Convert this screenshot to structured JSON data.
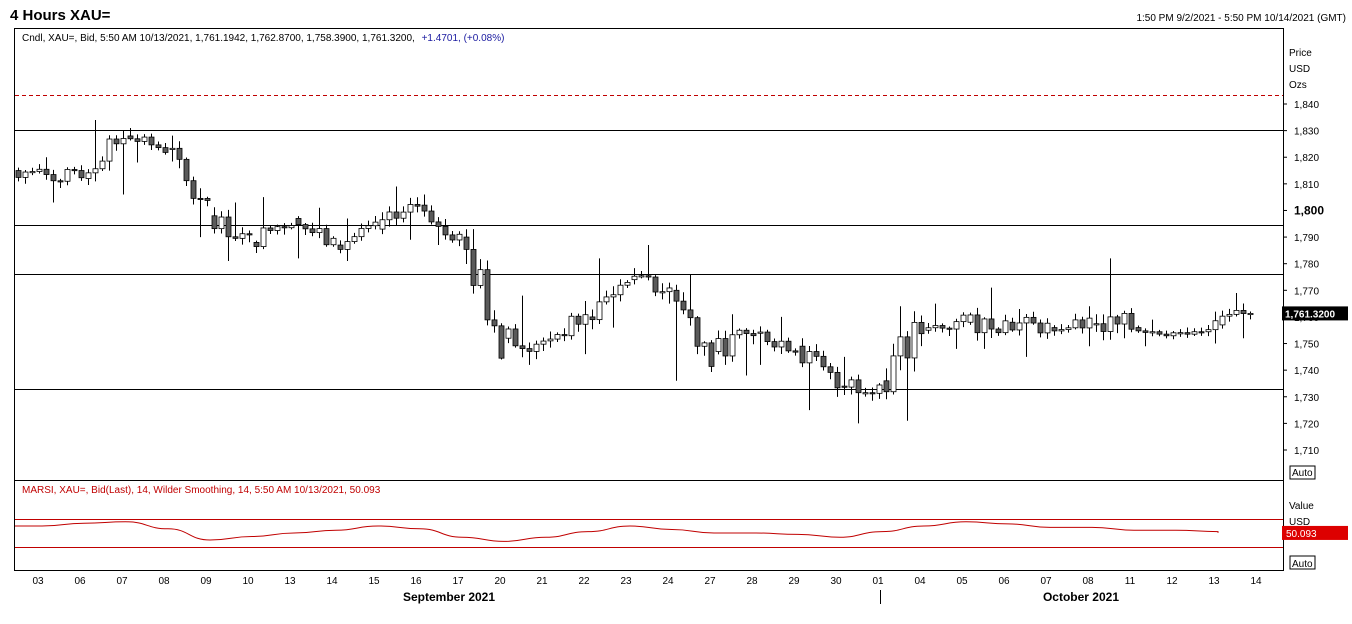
{
  "header": {
    "title": "4 Hours XAU=",
    "date_range": "1:50 PM 9/2/2021 - 5:50 PM 10/14/2021 (GMT)"
  },
  "price_panel": {
    "legend": {
      "prefix": "Cndl, XAU=, Bid, 5:50 AM 10/13/2021, 1,761.1942, 1,762.8700, 1,758.3900, 1,761.3200,",
      "change": "+1.4701, (+0.08%)"
    },
    "unit_lines": [
      "Price",
      "USD",
      "Ozs"
    ],
    "last_value_label": "1,761.3200",
    "auto_label": "Auto"
  },
  "rsi_panel": {
    "legend": "MARSI, XAU=, Bid(Last), 14, Wilder Smoothing, 14, 5:50 AM 10/13/2021, 50.093",
    "unit_lines": [
      "Value",
      "USD"
    ],
    "last_value_label": "50.093",
    "auto_label": "Auto"
  },
  "x_axis": {
    "day_labels": [
      "03",
      "06",
      "07",
      "08",
      "09",
      "10",
      "13",
      "14",
      "15",
      "16",
      "17",
      "20",
      "21",
      "22",
      "23",
      "24",
      "27",
      "28",
      "29",
      "30",
      "01",
      "04",
      "05",
      "06",
      "07",
      "08",
      "11",
      "12",
      "13",
      "14"
    ],
    "month_labels": [
      "September 2021",
      "October 2021"
    ]
  },
  "colors": {
    "up_body": "#ffffff",
    "down_body": "#5a5a5a",
    "wick": "#000000",
    "dashed_line": "#c00000",
    "rsi_line": "#c00000",
    "rsi_band": "#c00000",
    "last_label_bg": "#000000",
    "rsi_label_bg": "#dd0000",
    "change_text": "#1a1aa0",
    "rsi_legend_text": "#c00000"
  },
  "chart_data": [
    {
      "type": "candlestick",
      "title": "4 Hours XAU=",
      "y_axis": {
        "tick_labels": [
          "1,840",
          "1,830",
          "1,820",
          "1,810",
          "1,800",
          "1,790",
          "1,780",
          "1,770",
          "1,760",
          "1,750",
          "1,740",
          "1,730",
          "1,720",
          "1,710"
        ],
        "tick_values": [
          1840,
          1830,
          1820,
          1810,
          1800,
          1790,
          1780,
          1770,
          1760,
          1750,
          1740,
          1730,
          1720,
          1710
        ],
        "bold_tick": 1800,
        "range": [
          1705,
          1850
        ]
      },
      "horizontal_lines": [
        {
          "value": 1843.5,
          "style": "dashed"
        },
        {
          "value": 1830.3,
          "style": "solid"
        },
        {
          "value": 1794.6,
          "style": "solid"
        },
        {
          "value": 1776.2,
          "style": "solid"
        },
        {
          "value": 1732.8,
          "style": "solid"
        }
      ],
      "last_value": 1761.32,
      "segments": [
        {
          "day": "03",
          "start": 1815,
          "end": 1812,
          "high": 1820,
          "low": 1803,
          "bars": 10
        },
        {
          "day": "06",
          "start": 1812,
          "end": 1828,
          "high": 1834,
          "low": 1806,
          "bars": 6
        },
        {
          "day": "07",
          "start": 1828,
          "end": 1823,
          "high": 1831,
          "low": 1818,
          "bars": 6
        },
        {
          "day": "08",
          "start": 1823,
          "end": 1798,
          "high": 1826,
          "low": 1790,
          "bars": 6
        },
        {
          "day": "09",
          "start": 1798,
          "end": 1788,
          "high": 1803,
          "low": 1781,
          "bars": 6
        },
        {
          "day": "10",
          "start": 1788,
          "end": 1797,
          "high": 1805,
          "low": 1784,
          "bars": 6
        },
        {
          "day": "13",
          "start": 1797,
          "end": 1787,
          "high": 1801,
          "low": 1782,
          "bars": 6
        },
        {
          "day": "14",
          "start": 1787,
          "end": 1793,
          "high": 1797,
          "low": 1781,
          "bars": 6
        },
        {
          "day": "15",
          "start": 1793,
          "end": 1802,
          "high": 1809,
          "low": 1789,
          "bars": 6
        },
        {
          "day": "16",
          "start": 1802,
          "end": 1790,
          "high": 1806,
          "low": 1787,
          "bars": 6
        },
        {
          "day": "17",
          "start": 1790,
          "end": 1752,
          "high": 1793,
          "low": 1744,
          "bars": 6
        },
        {
          "day": "20",
          "start": 1752,
          "end": 1751,
          "high": 1768,
          "low": 1742,
          "bars": 6
        },
        {
          "day": "21",
          "start": 1751,
          "end": 1760,
          "high": 1766,
          "low": 1746,
          "bars": 6
        },
        {
          "day": "22",
          "start": 1760,
          "end": 1774,
          "high": 1782,
          "low": 1756,
          "bars": 6
        },
        {
          "day": "23",
          "start": 1774,
          "end": 1770,
          "high": 1787,
          "low": 1765,
          "bars": 6
        },
        {
          "day": "24",
          "start": 1770,
          "end": 1747,
          "high": 1776,
          "low": 1736,
          "bars": 6
        },
        {
          "day": "27",
          "start": 1747,
          "end": 1754,
          "high": 1761,
          "low": 1738,
          "bars": 6
        },
        {
          "day": "28",
          "start": 1754,
          "end": 1749,
          "high": 1760,
          "low": 1742,
          "bars": 6
        },
        {
          "day": "29",
          "start": 1749,
          "end": 1734,
          "high": 1752,
          "low": 1725,
          "bars": 6
        },
        {
          "day": "30",
          "start": 1734,
          "end": 1736,
          "high": 1745,
          "low": 1720,
          "bars": 6
        },
        {
          "day": "01",
          "start": 1736,
          "end": 1755,
          "high": 1764,
          "low": 1721,
          "bars": 6
        },
        {
          "day": "04",
          "start": 1755,
          "end": 1758,
          "high": 1765,
          "low": 1748,
          "bars": 6
        },
        {
          "day": "05",
          "start": 1758,
          "end": 1758,
          "high": 1771,
          "low": 1748,
          "bars": 6
        },
        {
          "day": "06",
          "start": 1758,
          "end": 1756,
          "high": 1763,
          "low": 1745,
          "bars": 6
        },
        {
          "day": "07",
          "start": 1756,
          "end": 1757,
          "high": 1764,
          "low": 1749,
          "bars": 6
        },
        {
          "day": "08",
          "start": 1757,
          "end": 1756,
          "high": 1782,
          "low": 1752,
          "bars": 6
        },
        {
          "day": "11",
          "start": 1756,
          "end": 1754,
          "high": 1759,
          "low": 1749,
          "bars": 6
        },
        {
          "day": "12",
          "start": 1754,
          "end": 1757,
          "high": 1762,
          "low": 1750,
          "bars": 6
        },
        {
          "day": "13",
          "start": 1757,
          "end": 1761.32,
          "high": 1769,
          "low": 1752,
          "bars": 5
        }
      ]
    },
    {
      "type": "line",
      "title": "MARSI, XAU=, Bid(Last), 14, Wilder Smoothing, 14",
      "y_axis": {
        "range": [
          0,
          100
        ],
        "bands": [
          70,
          30
        ]
      },
      "last_value": 50.093,
      "series": [
        {
          "x_days": [
            "03",
            "06",
            "07",
            "08",
            "09",
            "10",
            "13",
            "14",
            "15",
            "16",
            "17",
            "20",
            "21",
            "22",
            "23",
            "24",
            "27",
            "28",
            "29",
            "30",
            "01",
            "04",
            "05",
            "06",
            "07",
            "08",
            "11",
            "12",
            "13"
          ],
          "values": [
            60,
            64,
            66,
            56,
            40,
            45,
            50,
            54,
            60,
            56,
            44,
            38,
            44,
            52,
            60,
            55,
            50,
            50,
            48,
            44,
            52,
            60,
            66,
            63,
            58,
            58,
            54,
            54,
            52
          ]
        }
      ]
    }
  ]
}
